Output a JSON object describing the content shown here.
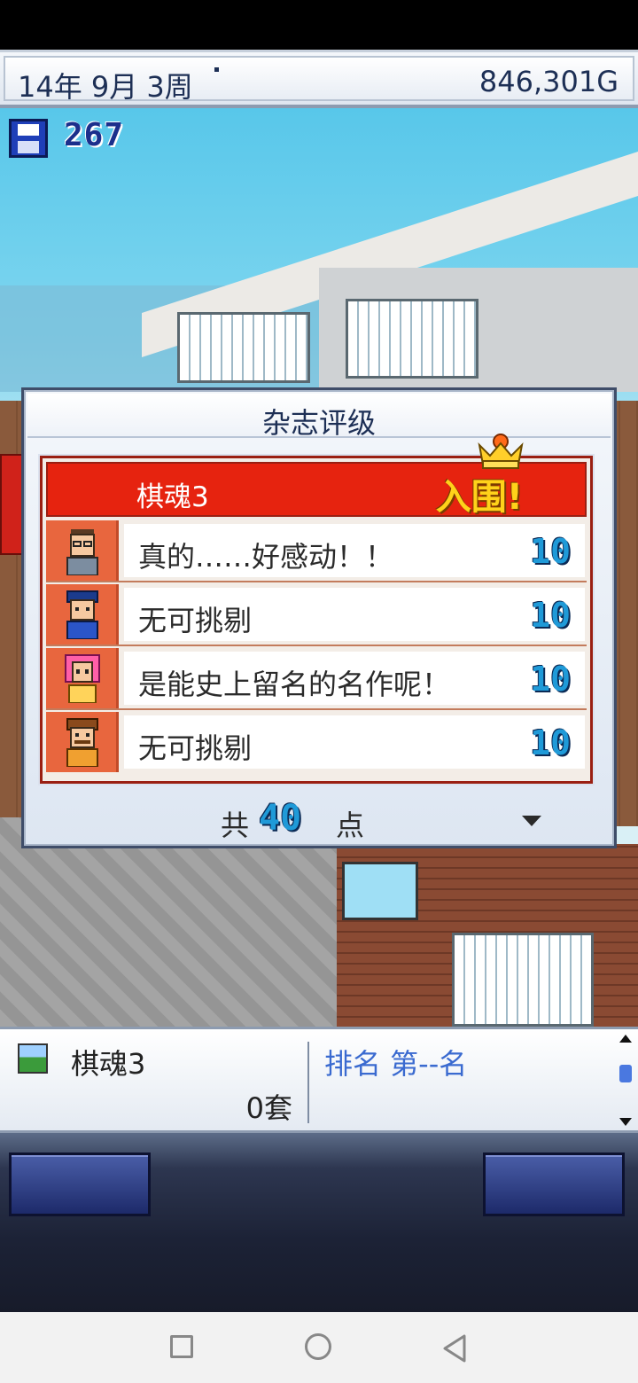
{
  "top_bar": {
    "date": "14年 9月 3周",
    "money": "846,301G"
  },
  "save_counter": {
    "icon": "floppy-disk-icon",
    "value": "267"
  },
  "review_panel": {
    "title": "杂志评级",
    "game_title": "棋魂3",
    "badge": "入围!",
    "reviews": [
      {
        "comment": "真的……好感动！！",
        "score": "10",
        "avatar": "reviewer-man-glasses"
      },
      {
        "comment": "无可挑剔",
        "score": "10",
        "avatar": "reviewer-man-cap"
      },
      {
        "comment": "是能史上留名的名作呢！",
        "score": "10",
        "avatar": "reviewer-woman-pink"
      },
      {
        "comment": "无可挑剔",
        "score": "10",
        "avatar": "reviewer-man-mustache"
      }
    ],
    "total_prefix": "共",
    "total_value": "40",
    "total_suffix": "点"
  },
  "info_bar": {
    "game_title": "棋魂3",
    "sets": "0套",
    "rank": "排名 第--名"
  },
  "colors": {
    "title_red": "#e6230f",
    "score_blue": "#1f9ad8",
    "badge_gold": "#ffd21a",
    "panel_navy": "#1d2f55"
  }
}
